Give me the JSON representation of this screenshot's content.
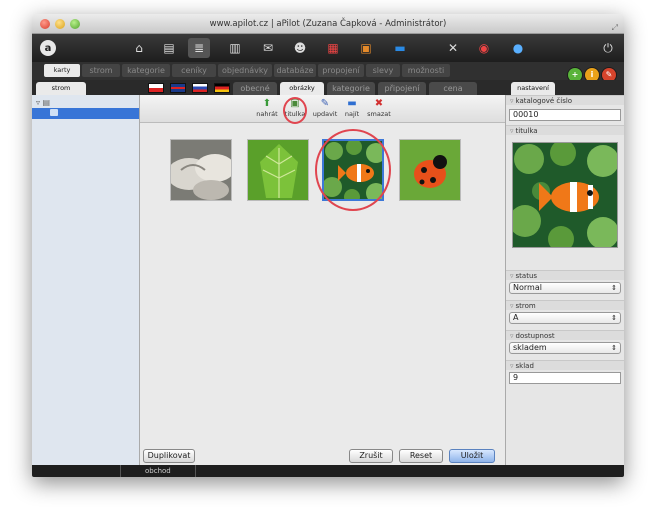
{
  "window": {
    "title": "www.apilot.cz | aPilot (Zuzana Čapková - Administrátor)"
  },
  "toolbar": {
    "logo": "a",
    "icons": [
      "home-icon",
      "document-icon",
      "database-icon",
      "clipboard-icon",
      "mail-icon",
      "people-icon",
      "calendar-icon",
      "cabinet-icon",
      "folder-icon",
      "tools-icon",
      "lifebuoy-icon",
      "globe-icon",
      "power-icon"
    ],
    "glyphs": {
      "home": "⌂",
      "document": "▤",
      "database": "≣",
      "clipboard": "▥",
      "mail": "✉",
      "people": "☻",
      "calendar": "▦",
      "cabinet": "▣",
      "folder": "▬",
      "tools": "✕",
      "lifebuoy": "◉",
      "globe": "●",
      "power": "⏻"
    }
  },
  "main_tabs": [
    "karty",
    "strom",
    "kategorie",
    "ceníky",
    "objednávky",
    "databáze",
    "propojení",
    "slevy",
    "možnosti"
  ],
  "orbs": [
    {
      "label": "+",
      "color": "#59b33a"
    },
    {
      "label": "i",
      "color": "#e9a21a"
    },
    {
      "label": "✎",
      "color": "#d6442c"
    }
  ],
  "left_panel": {
    "tab": "strom",
    "tree_item": "A"
  },
  "sub_tabs": [
    "obecné",
    "obrázky",
    "kategorie",
    "připojení",
    "cena"
  ],
  "flags": [
    "cz",
    "gb",
    "sk",
    "de"
  ],
  "actions": [
    {
      "name": "upload",
      "label": "nahrát",
      "glyph": "⬆",
      "color": "#3a9a3a"
    },
    {
      "name": "titulka",
      "label": "titulka",
      "glyph": "▣",
      "color": "#4a8a3a"
    },
    {
      "name": "update",
      "label": "updavit",
      "glyph": "✎",
      "color": "#3a5fb3"
    },
    {
      "name": "find",
      "label": "najít",
      "glyph": "▬",
      "color": "#2f6fd1"
    },
    {
      "name": "delete",
      "label": "smazat",
      "glyph": "✖",
      "color": "#d23030"
    }
  ],
  "thumbnails": [
    "stones",
    "leaf",
    "clownfish",
    "ladybug"
  ],
  "buttons": {
    "duplicate": "Duplikovat",
    "cancel": "Zrušit",
    "reset": "Reset",
    "save": "Uložit"
  },
  "right_panel": {
    "tab": "nastavení",
    "catalog_label": "katalogové číslo",
    "catalog_value": "00010",
    "cover_label": "titulka",
    "status_label": "status",
    "status_value": "Normal",
    "tree_label": "strom",
    "tree_value": "A",
    "availability_label": "dostupnost",
    "availability_value": "skladem",
    "stock_label": "sklad",
    "stock_value": "9"
  },
  "statusbar": {
    "label": "obchod"
  }
}
